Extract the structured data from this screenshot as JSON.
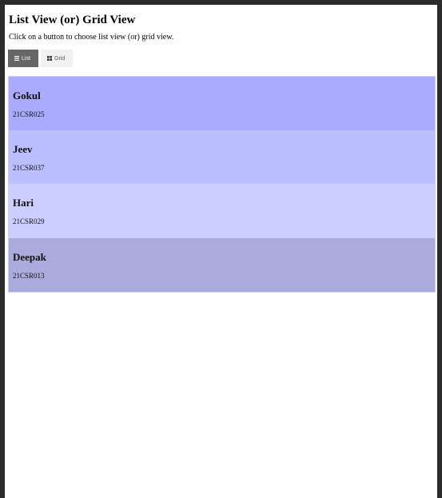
{
  "page": {
    "title": "List View (or) Grid View",
    "instructions": "Click on a button to choose list view (or) grid view."
  },
  "buttons": {
    "list_label": "List",
    "grid_label": "Grid",
    "active": "list"
  },
  "rows": [
    {
      "name": "Gokul",
      "code": "21CSR025",
      "color": "#aaaaff"
    },
    {
      "name": "Jeev",
      "code": "21CSR037",
      "color": "#bbbfff"
    },
    {
      "name": "Hari",
      "code": "21CSR029",
      "color": "#ccceff"
    },
    {
      "name": "Deepak",
      "code": "21CSR013",
      "color": "#aaaadd"
    }
  ]
}
